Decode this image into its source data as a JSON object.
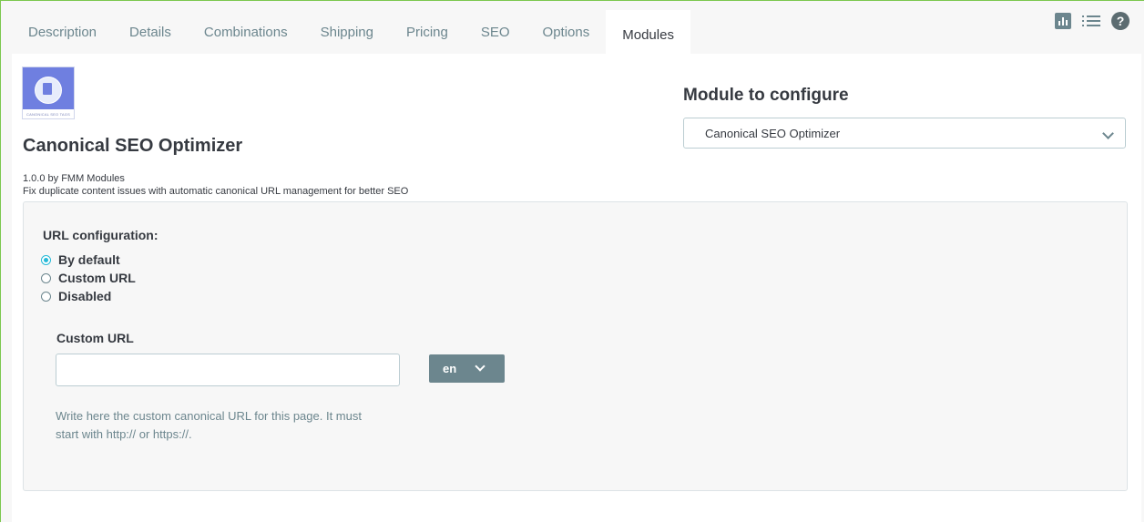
{
  "tabs": [
    {
      "label": "Description",
      "active": false
    },
    {
      "label": "Details",
      "active": false
    },
    {
      "label": "Combinations",
      "active": false
    },
    {
      "label": "Shipping",
      "active": false
    },
    {
      "label": "Pricing",
      "active": false
    },
    {
      "label": "SEO",
      "active": false
    },
    {
      "label": "Options",
      "active": false
    },
    {
      "label": "Modules",
      "active": true
    }
  ],
  "top_icons": [
    "stats-icon",
    "list-icon",
    "help-icon"
  ],
  "help_glyph": "?",
  "module": {
    "logo_text": "CANONICAL SEO TAGS",
    "title": "Canonical SEO Optimizer",
    "version_author": "1.0.0 by FMM Modules",
    "description": "Fix duplicate content issues with automatic canonical URL management for better SEO"
  },
  "configure": {
    "title": "Module to configure",
    "selected": "Canonical SEO Optimizer"
  },
  "url_config": {
    "label": "URL configuration:",
    "options": [
      {
        "label": "By default",
        "checked": true
      },
      {
        "label": "Custom URL",
        "checked": false
      },
      {
        "label": "Disabled",
        "checked": false
      }
    ],
    "custom_url_label": "Custom URL",
    "custom_url_value": "",
    "language": "en",
    "help": "Write here the custom canonical URL for this page. It must start with http:// or https://."
  },
  "colors": {
    "accent": "#25b9d7",
    "frame": "#7cc84f",
    "muted": "#6c868e"
  }
}
